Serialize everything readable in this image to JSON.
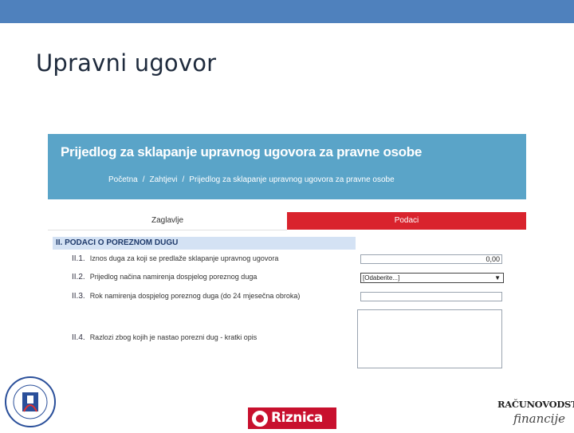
{
  "slide": {
    "title": "Upravni ugovor"
  },
  "form": {
    "title": "Prijedlog za sklapanje upravnog ugovora za pravne osobe",
    "breadcrumb": [
      "Početna",
      "Zahtjevi",
      "Prijedlog za sklapanje upravnog ugovora za pravne osobe"
    ],
    "tabs": [
      {
        "label": "Zaglavlje",
        "active": false
      },
      {
        "label": "Podaci",
        "active": true
      }
    ],
    "section_title": "II. PODACI O POREZNOM DUGU",
    "rows": [
      {
        "num": "II.1.",
        "label": "Iznos duga za koji se predlaže sklapanje upravnog ugovora",
        "value": "0,00"
      },
      {
        "num": "II.2.",
        "label": "Prijedlog načina namirenja dospjelog poreznog duga",
        "value": "[Odaberite...]"
      },
      {
        "num": "II.3.",
        "label": "Rok namirenja dospjelog poreznog duga (do 24 mjesečna obroka)",
        "value": ""
      },
      {
        "num": "II.4.",
        "label": "Razlozi zbog kojih je nastao porezni dug - kratki opis",
        "value": ""
      }
    ]
  },
  "logos": {
    "left": {
      "name": "seal-logo"
    },
    "middle": {
      "text": "Riznica"
    },
    "right": {
      "line1": "RAČUNOVODSTVO",
      "line2": "financije"
    }
  },
  "colors": {
    "top_bar": "#4f81bd",
    "form_header": "#5aa4c8",
    "active_tab": "#d9232d",
    "section_head": "#d4e2f4"
  }
}
